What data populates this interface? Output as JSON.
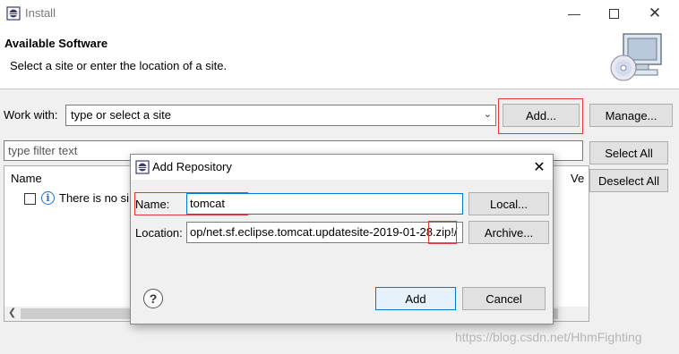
{
  "window": {
    "title": "Install",
    "minimize_icon": "minimize-icon",
    "maximize_icon": "maximize-icon",
    "close_icon": "close-icon"
  },
  "header": {
    "title": "Available Software",
    "subtitle": "Select a site or enter the location of a site.",
    "art_icon": "monitor-cd-icon"
  },
  "work_with": {
    "label": "Work with:",
    "value": "type or select a site",
    "add_label": "Add...",
    "manage_label": "Manage..."
  },
  "filter": {
    "placeholder": "type filter text"
  },
  "side_buttons": {
    "select_all": "Select All",
    "deselect_all": "Deselect All"
  },
  "table": {
    "columns": [
      "Name",
      "Ve"
    ],
    "rows": [
      {
        "text": "There is no si",
        "checked": false
      }
    ]
  },
  "dialog": {
    "title": "Add Repository",
    "name_label": "Name:",
    "name_value": "tomcat",
    "location_label": "Location:",
    "location_value": "op/net.sf.eclipse.tomcat.updatesite-2019-01-28.zip!/",
    "local_label": "Local...",
    "archive_label": "Archive...",
    "add_label": "Add",
    "cancel_label": "Cancel",
    "help_icon": "help-icon"
  },
  "watermark": "https://blog.csdn.net/HhmFighting",
  "colors": {
    "accent_blue": "#0078d7",
    "highlight_red": "#e53935"
  }
}
